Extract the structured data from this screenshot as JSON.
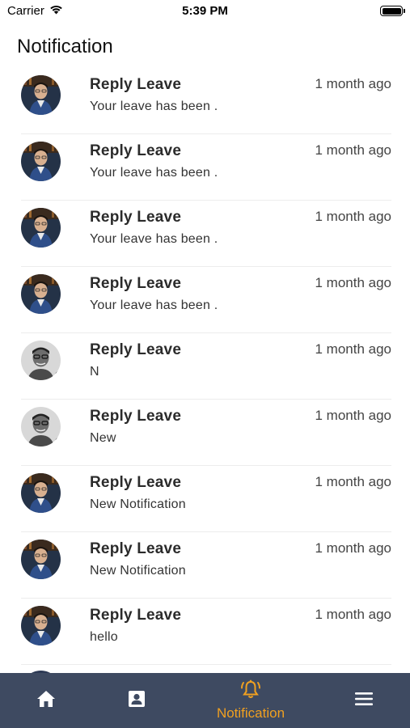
{
  "status_bar": {
    "carrier": "Carrier",
    "time": "5:39 PM"
  },
  "page": {
    "title": "Notification"
  },
  "notifications": [
    {
      "title": "Reply Leave",
      "time": "1 month ago",
      "body": "Your leave has been .",
      "avatar": "user-a"
    },
    {
      "title": "Reply Leave",
      "time": "1 month ago",
      "body": "Your leave has been .",
      "avatar": "user-a"
    },
    {
      "title": "Reply Leave",
      "time": "1 month ago",
      "body": "Your leave has been .",
      "avatar": "user-a"
    },
    {
      "title": "Reply Leave",
      "time": "1 month ago",
      "body": "Your leave has been .",
      "avatar": "user-a"
    },
    {
      "title": "Reply Leave",
      "time": "1 month ago",
      "body": "N",
      "avatar": "user-b"
    },
    {
      "title": "Reply Leave",
      "time": "1 month ago",
      "body": "New",
      "avatar": "user-b"
    },
    {
      "title": "Reply Leave",
      "time": "1 month ago",
      "body": "New Notification",
      "avatar": "user-a"
    },
    {
      "title": "Reply Leave",
      "time": "1 month ago",
      "body": "New Notification",
      "avatar": "user-a"
    },
    {
      "title": "Reply Leave",
      "time": "1 month ago",
      "body": "hello",
      "avatar": "user-a"
    }
  ],
  "tab_bar": {
    "tabs": [
      {
        "icon": "home-icon",
        "label": "",
        "active": false
      },
      {
        "icon": "contact-card-icon",
        "label": "",
        "active": false
      },
      {
        "icon": "bell-icon",
        "label": "Notification",
        "active": true
      },
      {
        "icon": "menu-icon",
        "label": "",
        "active": false
      }
    ]
  },
  "colors": {
    "tab_bar_bg": "#3e4a61",
    "active_accent": "#f0a020",
    "inactive_icon": "#ffffff"
  }
}
